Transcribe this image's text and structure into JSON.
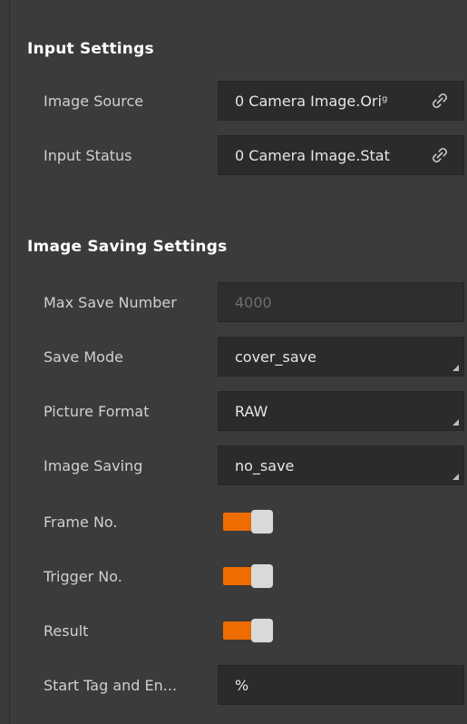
{
  "sections": {
    "input": {
      "title": "Input Settings",
      "rows": {
        "image_source": {
          "label": "Image Source",
          "value": "0 Camera Image.Oriᵍ"
        },
        "input_status": {
          "label": "Input Status",
          "value": "0 Camera Image.Stat"
        }
      }
    },
    "image_saving": {
      "title": "Image Saving Settings",
      "rows": {
        "max_save_number": {
          "label": "Max Save Number",
          "value": "4000"
        },
        "save_mode": {
          "label": "Save Mode",
          "value": "cover_save"
        },
        "picture_format": {
          "label": "Picture Format",
          "value": "RAW"
        },
        "image_saving": {
          "label": "Image Saving",
          "value": "no_save"
        },
        "frame_no": {
          "label": "Frame No.",
          "enabled": true
        },
        "trigger_no": {
          "label": "Trigger No.",
          "enabled": true
        },
        "result": {
          "label": "Result",
          "enabled": true
        },
        "start_tag": {
          "label": "Start Tag and En...",
          "value": "%"
        }
      }
    }
  },
  "icons": {
    "link": "link-icon",
    "dropdown": "dropdown-corner-icon"
  },
  "colors": {
    "background": "#3b3b3b",
    "field_bg": "#2b2b2b",
    "accent": "#ef6c00",
    "text": "#d0d0d0",
    "title": "#ffffff"
  }
}
